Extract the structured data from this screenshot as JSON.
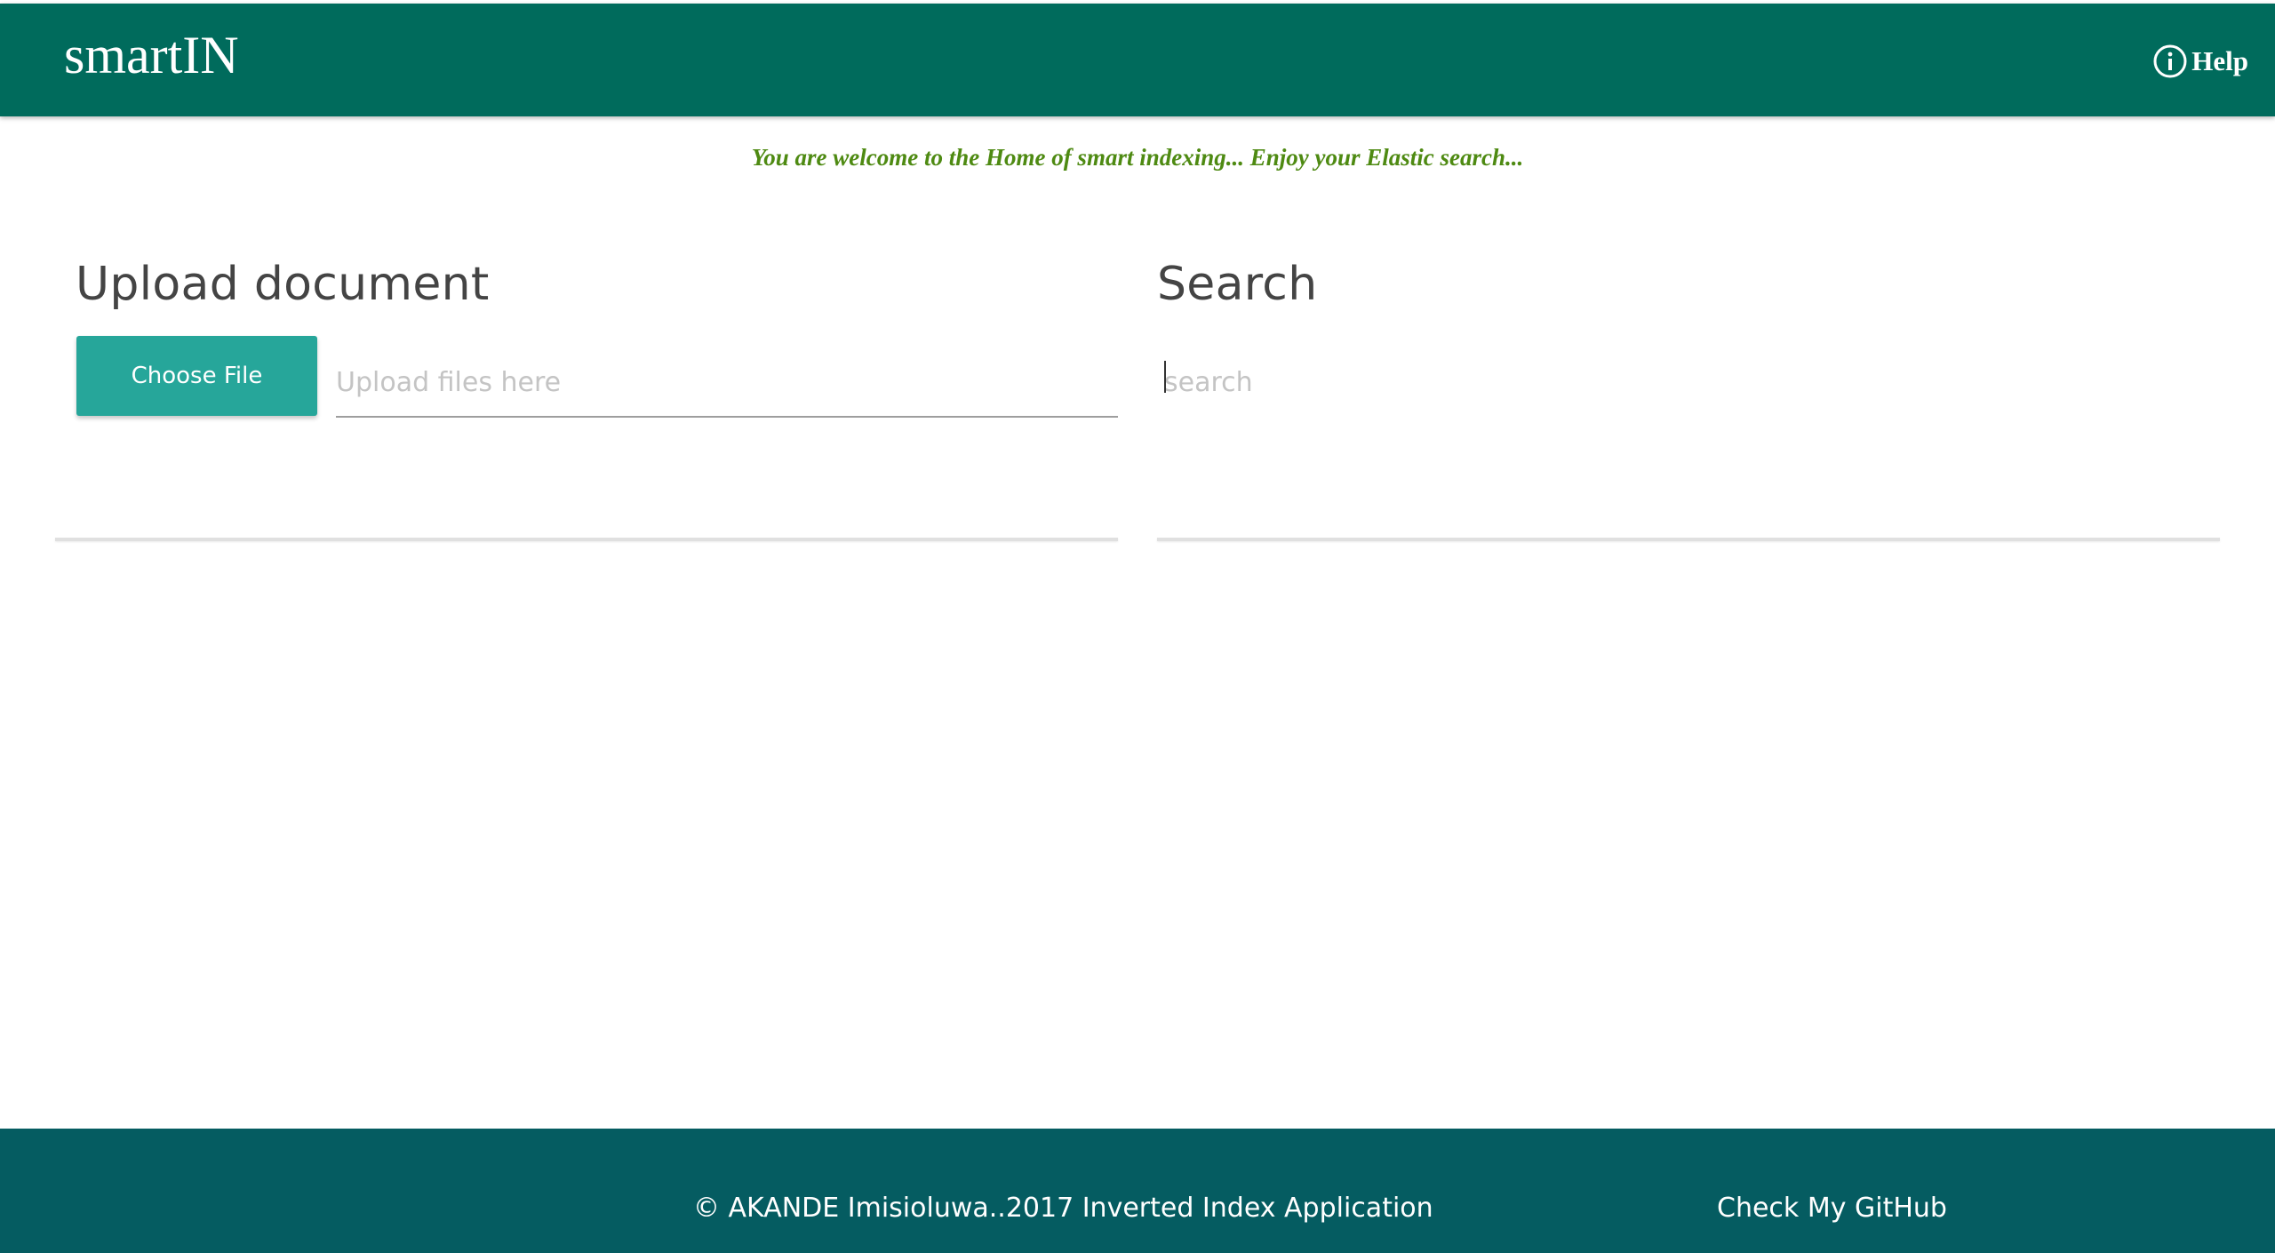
{
  "navbar": {
    "brand": "smartIN",
    "help_label": "Help",
    "help_icon": "info-icon",
    "background_color": "#006b5c"
  },
  "welcome": {
    "message": "You are welcome to the Home of smart indexing... Enjoy your Elastic search..."
  },
  "upload": {
    "title": "Upload document",
    "button_label": "Choose File",
    "placeholder": "Upload files here",
    "value": ""
  },
  "search": {
    "title": "Search",
    "placeholder": "search",
    "value": ""
  },
  "footer": {
    "copyright": "© AKANDE Imisioluwa..2017 Inverted Index Application",
    "github_link": "Check My GitHub",
    "background_color": "#055c61"
  },
  "colors": {
    "accent_button": "#26a69a",
    "welcome_text": "#4e8a12"
  }
}
